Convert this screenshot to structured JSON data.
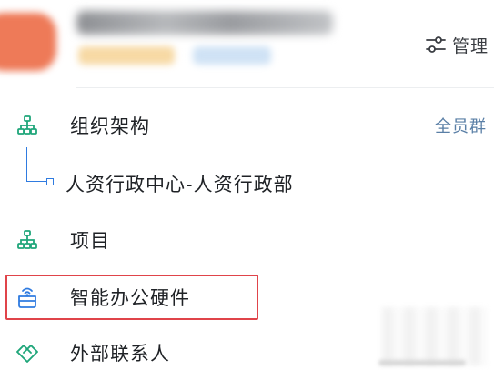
{
  "header": {
    "manage_label": "管理",
    "icons": {
      "manage": "sliders-icon"
    }
  },
  "menu": {
    "org_structure": {
      "label": "组织架构",
      "action_label": "全员群",
      "icon": "org-chart-icon"
    },
    "department": {
      "label": "人资行政中心-人资行政部",
      "icon": "tree-node-icon"
    },
    "project": {
      "label": "项目",
      "icon": "org-chart-icon"
    },
    "smart_hardware": {
      "label": "智能办公硬件",
      "icon": "router-icon",
      "highlighted": true
    },
    "external_contacts": {
      "label": "外部联系人",
      "icon": "handshake-icon"
    }
  },
  "colors": {
    "accent_green": "#1fa67a",
    "accent_blue": "#2f7be0",
    "link_blue": "#5a7fa6",
    "highlight_red": "#e0444a",
    "text_primary": "#1f2226"
  }
}
